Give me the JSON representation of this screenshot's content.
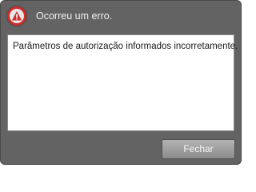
{
  "dialog": {
    "title": "Ocorreu um erro.",
    "icon": "error-warning-icon",
    "message": "Parâmetros de autorização informados incorretamente.",
    "close_label": "Fechar"
  },
  "colors": {
    "dialog_background": "#636363",
    "icon_accent": "#cf2b2b",
    "message_background": "#ffffff"
  }
}
